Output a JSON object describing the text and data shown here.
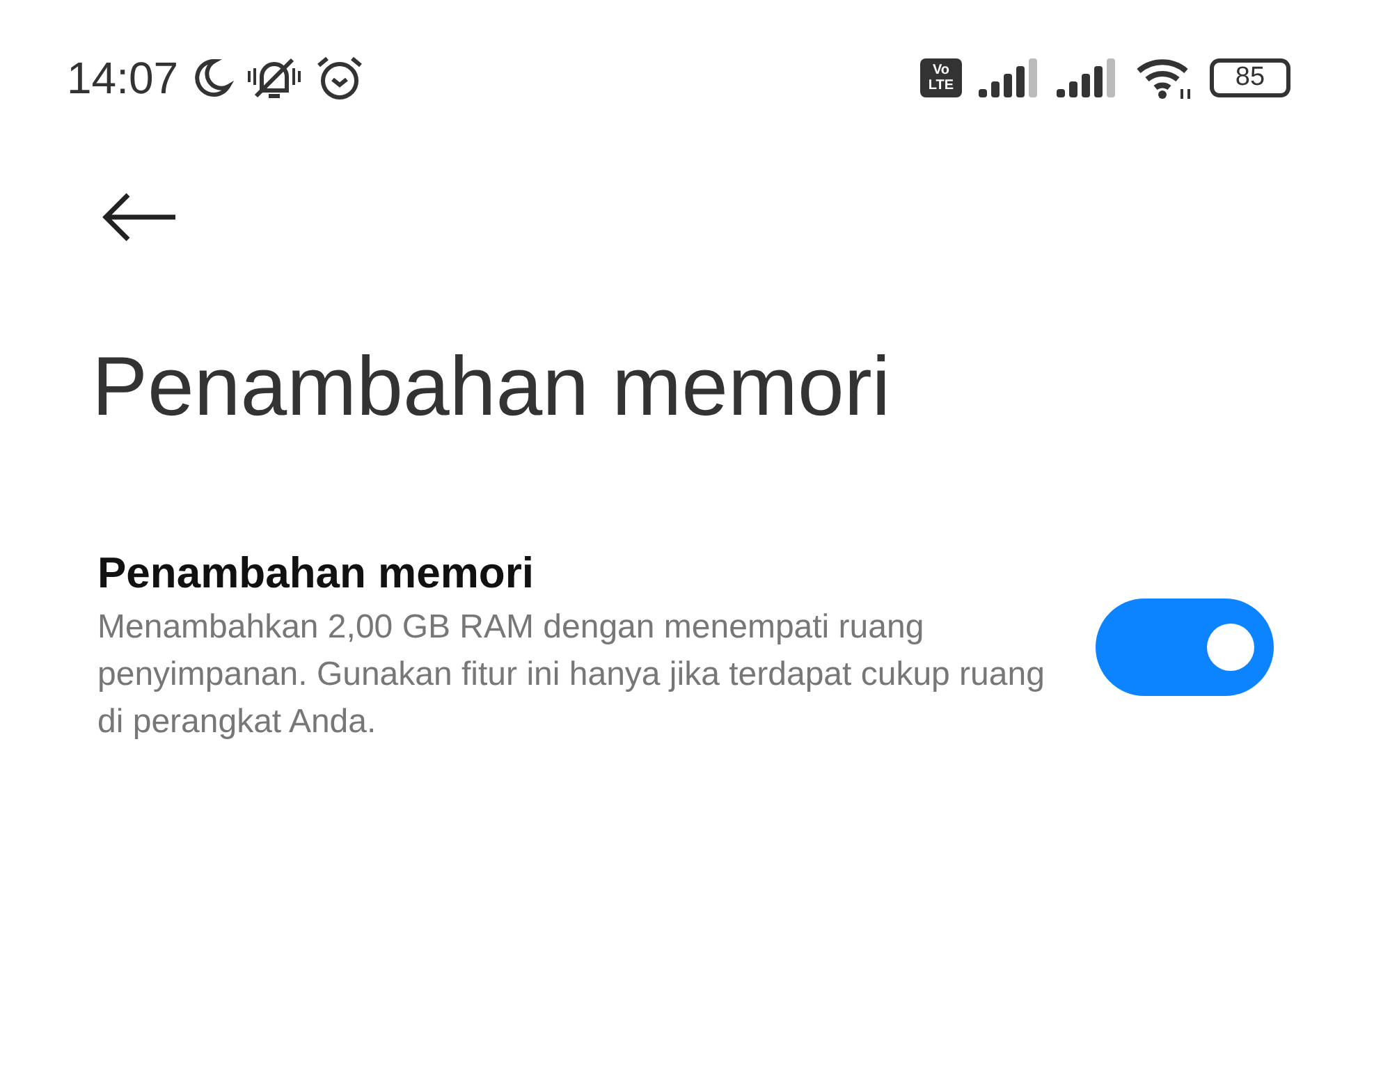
{
  "status_bar": {
    "time": "14:07",
    "volte": [
      "Vo",
      "LTE"
    ],
    "battery": "85"
  },
  "page": {
    "title": "Penambahan memori"
  },
  "setting": {
    "title": "Penambahan memori",
    "description": "Menambahkan 2,00 GB RAM dengan menempati ruang penyimpanan. Gunakan fitur ini hanya jika terdapat cukup ruang di perangkat Anda.",
    "on": true
  }
}
